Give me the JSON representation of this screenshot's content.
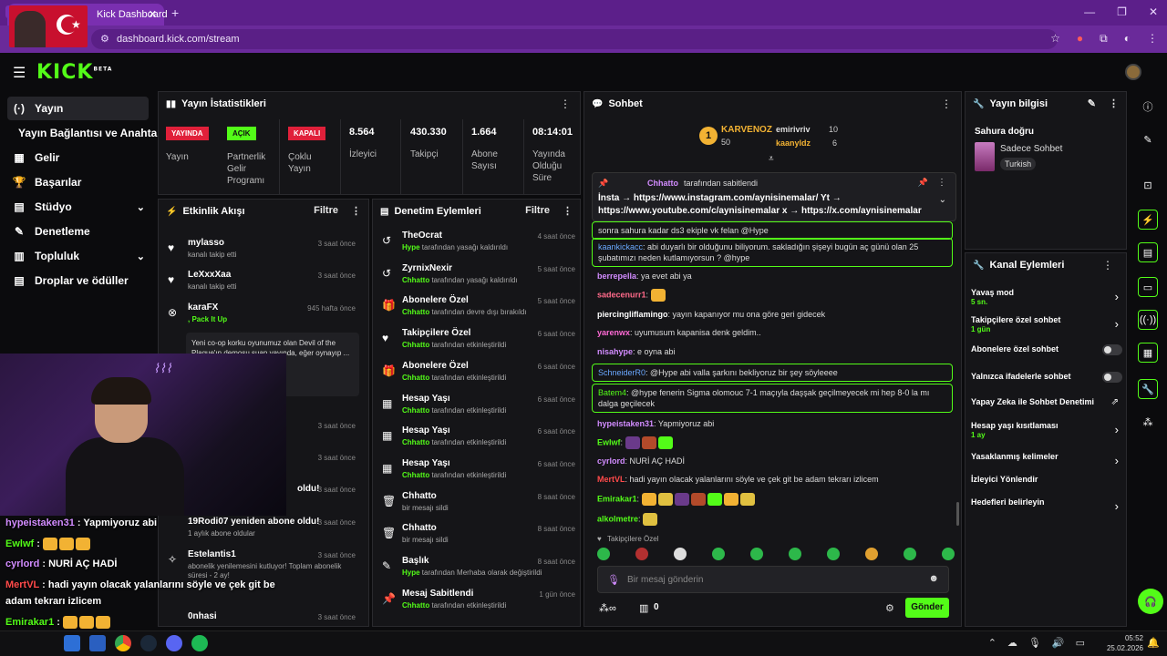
{
  "browser": {
    "tab_title": "Kick Dashboard",
    "url": "dashboard.kick.com/stream"
  },
  "header": {
    "logo": "KICK",
    "logo_beta": "BETA"
  },
  "nav": {
    "items": [
      {
        "label": "Yayın",
        "icon": "(·)"
      },
      {
        "label": "Yayın Bağlantısı ve Anahtarı",
        "icon": ""
      },
      {
        "label": "Gelir",
        "icon": "▦"
      },
      {
        "label": "Başarılar",
        "icon": "🏆"
      },
      {
        "label": "Stüdyo",
        "icon": "▤"
      },
      {
        "label": "Denetleme",
        "icon": "✎"
      },
      {
        "label": "Topluluk",
        "icon": "▥"
      },
      {
        "label": "Droplar ve ödüller",
        "icon": "▤"
      }
    ]
  },
  "stats": {
    "title": "Yayın İstatistikleri",
    "badges": [
      {
        "text": "YAYINDA",
        "label": "Yayın",
        "color": "#e0203a"
      },
      {
        "text": "AÇIK",
        "label": "Partnerlik Gelir Programı",
        "color": "#53fc18"
      },
      {
        "text": "KAPALI",
        "label": "Çoklu Yayın",
        "color": "#e0203a"
      }
    ],
    "numbers": [
      {
        "value": "8.564",
        "label": "İzleyici"
      },
      {
        "value": "430.330",
        "label": "Takipçi"
      },
      {
        "value": "1.664",
        "label": "Abone Sayısı"
      },
      {
        "value": "08:14:01",
        "label": "Yayında Olduğu Süre"
      }
    ]
  },
  "activity": {
    "title": "Etkinlik Akışı",
    "filter": "Filtre",
    "rows": [
      {
        "name": "mylasso",
        "sub": "kanalı takip etti",
        "time": "3 saat önce"
      },
      {
        "name": "LeXxxXaa",
        "sub": "kanalı takip etti",
        "time": "3 saat önce"
      },
      {
        "name": "karaFX",
        "sub": ", Pack It Up",
        "time": "945 hafta önce"
      }
    ],
    "karafx_message": "Yeni co-op korku oyunumuz olan Devil of the Plague'ın demosu şuan yayında, eğer oynayıp ... utlu oluruz. İyi",
    "lower_rows": [
      {
        "name": "",
        "sub": "",
        "time": "3 saat önce"
      },
      {
        "name": "",
        "sub": "",
        "time": "3 saat önce"
      },
      {
        "name": "oldu!",
        "sub": "",
        "time": "3 saat önce"
      },
      {
        "name": "19Rodi07 yeniden abone oldu!",
        "sub": "1 aylık abone oldular",
        "time": "3 saat önce"
      },
      {
        "name": "Estelantis1",
        "sub": "abonelik yenilemesini kutluyor! Toplam abonelik süresi - 2 ay!",
        "time": "3 saat önce"
      },
      {
        "name": "0nhasi",
        "sub": "",
        "time": "3 saat önce"
      }
    ]
  },
  "moderation": {
    "title": "Denetim Eylemleri",
    "filter": "Filtre",
    "rows": [
      {
        "name": "TheOcrat",
        "actor": "Hype",
        "sub": "tarafından yasağı kaldırıldı",
        "time": "4 saat önce",
        "icon": "↺"
      },
      {
        "name": "ZyrnixNexir",
        "actor": "Chhatto",
        "sub": "tarafından yasağı kaldırıldı",
        "time": "5 saat önce",
        "icon": "↺"
      },
      {
        "name": "Abonelere Özel",
        "actor": "Chhatto",
        "sub": "tarafından devre dışı bırakıldı",
        "time": "5 saat önce",
        "icon": "🎁"
      },
      {
        "name": "Takipçilere Özel",
        "actor": "Chhatto",
        "sub": "tarafından etkinleştirildi",
        "time": "6 saat önce",
        "icon": "♥"
      },
      {
        "name": "Abonelere Özel",
        "actor": "Chhatto",
        "sub": "tarafından etkinleştirildi",
        "time": "6 saat önce",
        "icon": "🎁"
      },
      {
        "name": "Hesap Yaşı",
        "actor": "Chhatto",
        "sub": "tarafından etkinleştirildi",
        "time": "6 saat önce",
        "icon": "▦"
      },
      {
        "name": "Hesap Yaşı",
        "actor": "Chhatto",
        "sub": "tarafından etkinleştirildi",
        "time": "6 saat önce",
        "icon": "▦"
      },
      {
        "name": "Hesap Yaşı",
        "actor": "Chhatto",
        "sub": "tarafından etkinleştirildi",
        "time": "6 saat önce",
        "icon": "▦"
      },
      {
        "name": "Chhatto",
        "actor": "",
        "sub": "bir mesajı sildi",
        "time": "8 saat önce",
        "icon": "🗑"
      },
      {
        "name": "Chhatto",
        "actor": "",
        "sub": "bir mesajı sildi",
        "time": "8 saat önce",
        "icon": "🗑"
      },
      {
        "name": "Başlık",
        "actor": "Hype",
        "sub": "tarafından Merhaba olarak değiştirildi",
        "time": "8 saat önce",
        "icon": "✎"
      },
      {
        "name": "Mesaj Sabitlendi",
        "actor": "Chhatto",
        "sub": "tarafından etkinleştirildi",
        "time": "1 gün önce",
        "icon": "📌"
      }
    ]
  },
  "chat": {
    "title": "Sohbet",
    "leaderboard": {
      "first_name": "KARVENOZ",
      "first_score": "50",
      "first_rank": "1",
      "second_name": "emirivriv",
      "second_score": "10",
      "third_name": "kaanyldz",
      "third_score": "6"
    },
    "pinned": {
      "by": "Chhatto",
      "by_suffix": "tarafından sabitlendi",
      "line1": "İnsta → https://www.instagram.com/aynisinemalar/ Yt →",
      "line2": "https://www.youtube.com/c/aynisinemalar x → https://x.com/aynisinemalar"
    },
    "messages": [
      {
        "user": "",
        "text": "sonra sahura kadar ds3 ekiple vk felan @Hype",
        "boxed": true,
        "color": "#ddd"
      },
      {
        "user": "kaankickacc",
        "text": "abi duyarlı bir olduğunu biliyorum. sakladığın şişeyi bugün aç günü olan 25 şubatımızı neden kutlamıyorsun ? @hype",
        "boxed": true,
        "color": "#6aa8ff"
      },
      {
        "user": "berrepella",
        "text": "ya evet abi ya",
        "boxed": false,
        "color": "#d28cff"
      },
      {
        "user": "sadecenurr1",
        "text": "",
        "boxed": false,
        "color": "#ff6a8a"
      },
      {
        "user": "piercingliflamingo",
        "text": "yayın kapanıyor mu ona göre geri gidecek",
        "boxed": false,
        "color": "#ffffff"
      },
      {
        "user": "yarenwx",
        "text": "uyumusum kapanisa denk geldim..",
        "boxed": false,
        "color": "#ff6ad5"
      },
      {
        "user": "nisahype",
        "text": "e oyna abi",
        "boxed": false,
        "color": "#d28cff"
      },
      {
        "user": "SchneiderR0",
        "text": "@Hype abi valla şarkını bekliyoruz bir şey söyleeee",
        "boxed": true,
        "color": "#6aa8ff"
      },
      {
        "user": "Batem4",
        "text": "@hype fenerin Sigma olomouc 7-1 maçıyla daşşak geçilmeyecek mi hep 8-0 la mı dalga geçilecek",
        "boxed": true,
        "color": "#53fc18"
      },
      {
        "user": "hypeistaken31",
        "text": "Yapmiyoruz abi",
        "boxed": false,
        "color": "#d28cff"
      },
      {
        "user": "Ewlwf",
        "text": "",
        "boxed": false,
        "color": "#53fc18"
      },
      {
        "user": "cyrlord",
        "text": "NURİ AÇ HADİ",
        "boxed": false,
        "color": "#d28cff"
      },
      {
        "user": "MertVL",
        "text": "hadi yayın olacak yalanlarını söyle ve çek git be adam tekrarı izlicem",
        "boxed": false,
        "color": "#ff4a4a"
      },
      {
        "user": "Emirakar1",
        "text": "",
        "boxed": false,
        "color": "#53fc18"
      },
      {
        "user": "alkolmetre",
        "text": "",
        "boxed": false,
        "color": "#53fc18"
      }
    ],
    "followers_only_label": "Takipçilere Özel",
    "input_placeholder": "Bir mesaj gönderin",
    "points": "0",
    "send_label": "Gönder"
  },
  "stream_info": {
    "title": "Yayın bilgisi",
    "stream_title": "Sahura doğru",
    "category": "Sadece Sohbet",
    "tag": "Turkish"
  },
  "channel_actions": {
    "title": "Kanal Eylemleri",
    "items": [
      {
        "label": "Yavaş mod",
        "sub": "5 sn.",
        "control": "chevron"
      },
      {
        "label": "Takipçilere özel sohbet",
        "sub": "1 gün",
        "control": "chevron"
      },
      {
        "label": "Abonelere özel sohbet",
        "sub": "",
        "control": "toggle"
      },
      {
        "label": "Yalnızca ifadelerle sohbet",
        "sub": "",
        "control": "toggle"
      },
      {
        "label": "Yapay Zeka ile Sohbet Denetimi",
        "sub": "",
        "control": "external"
      },
      {
        "label": "Hesap yaşı kısıtlaması",
        "sub": "1 ay",
        "control": "chevron"
      },
      {
        "label": "Yasaklanmış kelimeler",
        "sub": "",
        "control": "chevron"
      },
      {
        "label": "İzleyici Yönlendir",
        "sub": "",
        "control": "none"
      },
      {
        "label": "Hedefleri belirleyin",
        "sub": "",
        "control": "chevron"
      }
    ]
  },
  "overlay_chat": [
    {
      "user": "hypeistaken31",
      "text": "Yapmiyoruz abi",
      "color": "#d28cff"
    },
    {
      "user": "Ewlwf",
      "text": "",
      "color": "#53fc18"
    },
    {
      "user": "cyrlord",
      "text": "NURİ AÇ HADİ",
      "color": "#d28cff"
    },
    {
      "user": "MertVL",
      "text": "hadi yayın olacak yalanlarını söyle ve çek git be",
      "color": "#ff4a4a"
    },
    {
      "user": "",
      "text": "adam tekrarı izlicem",
      "color": "#ffffff"
    },
    {
      "user": "Emirakar1",
      "text": "",
      "color": "#53fc18"
    },
    {
      "user": "alkolmetre",
      "text": "",
      "color": "#53fc18"
    }
  ],
  "taskbar": {
    "time": "05:52",
    "date": "25.02.2026"
  },
  "colors": {
    "accent": "#53fc18",
    "live": "#e0203a",
    "browser": "#5c1f8a"
  }
}
